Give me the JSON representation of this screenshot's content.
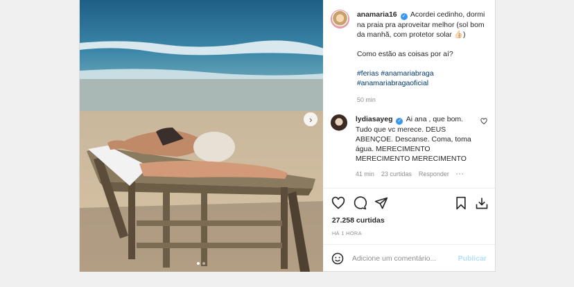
{
  "post": {
    "username": "anamaria16",
    "caption": "Acordei cedinho, dormi na praia pra aproveitar melhor (sol bom da manhã, com protetor solar 👍🏻)",
    "caption_line2": "Como estão as coisas por aí?",
    "hashtags_1": "#ferias #anamariabraga",
    "hashtags_2": "#anamariabragaoficial",
    "time": "50 min",
    "likes": "27.258 curtidas",
    "posted": "HÁ 1 HORA"
  },
  "comment": {
    "username": "lydiasayeg",
    "text": "Ai ana , que bom. Tudo que vc merece. DEUS ABENÇOE. Descanse. Coma, toma água. MERECIMENTO MERECIMENTO MERECIMENTO",
    "time": "41 min",
    "likes": "23 curtidas",
    "reply": "Responder",
    "more": "···"
  },
  "add_comment": {
    "placeholder": "Adicione um comentário...",
    "publish": "Publicar"
  },
  "icons": {
    "verified": "verified-badge-icon",
    "next": "chevron-right-icon",
    "like": "heart-icon",
    "comment": "comment-icon",
    "share": "send-icon",
    "save": "bookmark-icon",
    "download": "download-icon",
    "emoji": "emoji-icon"
  },
  "colors": {
    "link": "#00376b",
    "verified": "#3897f0",
    "publish": "#b2dffc",
    "muted": "#8e8e8e"
  }
}
